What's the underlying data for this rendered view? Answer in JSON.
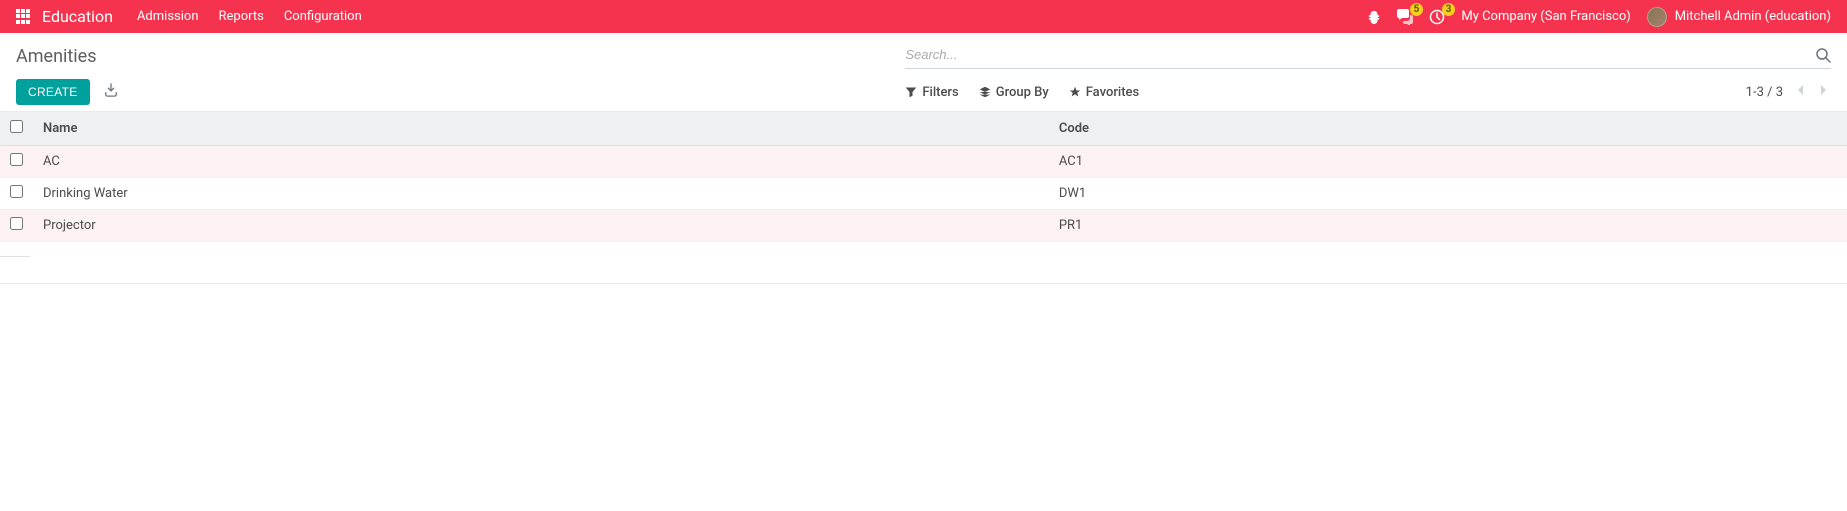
{
  "navbar": {
    "brand": "Education",
    "menu": [
      "Admission",
      "Reports",
      "Configuration"
    ],
    "messages_badge": "5",
    "activities_badge": "3",
    "company": "My Company (San Francisco)",
    "user": "Mitchell Admin (education)"
  },
  "control_panel": {
    "title": "Amenities",
    "search_placeholder": "Search...",
    "create_label": "CREATE",
    "filters_label": "Filters",
    "groupby_label": "Group By",
    "favorites_label": "Favorites",
    "pager": "1-3 / 3"
  },
  "table": {
    "columns": {
      "name": "Name",
      "code": "Code"
    },
    "rows": [
      {
        "name": "AC",
        "code": "AC1"
      },
      {
        "name": "Drinking Water",
        "code": "DW1"
      },
      {
        "name": "Projector",
        "code": "PR1"
      }
    ]
  },
  "colors": {
    "navbar_bg": "#f5334e",
    "create_bg": "#00a09d",
    "badge_bg": "#f7cd1f"
  }
}
